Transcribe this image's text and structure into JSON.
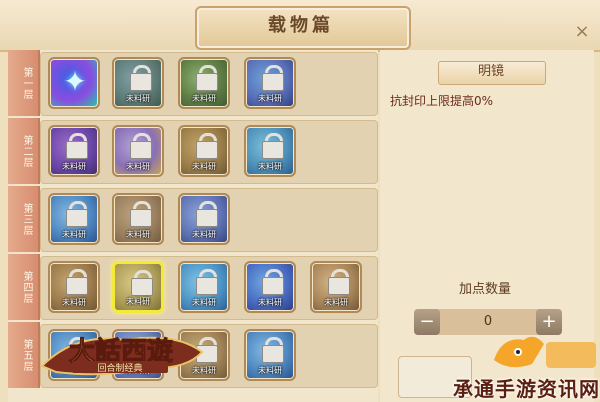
{
  "window": {
    "title": "载物篇",
    "close_glyph": "×"
  },
  "rows": [
    {
      "label": "第一层",
      "slots": [
        {
          "variant": "unlocked",
          "c1": "#3c5fe2",
          "c2": "#8a4de0",
          "c3": "#1ad0a8"
        },
        {
          "variant": "locked",
          "c1": "#7fa0a8",
          "c2": "#5f7c77",
          "c3": "#3d584b"
        },
        {
          "variant": "locked",
          "c1": "#8db06f",
          "c2": "#5e7d46",
          "c3": "#3c5a30"
        },
        {
          "variant": "locked",
          "c1": "#6ca4d8",
          "c2": "#5a6fb9",
          "c3": "#2e3d7a"
        }
      ]
    },
    {
      "label": "第二层",
      "slots": [
        {
          "variant": "locked",
          "c1": "#9e6cc8",
          "c2": "#6b47a8",
          "c3": "#3e2b6a"
        },
        {
          "variant": "locked",
          "c1": "#b0a2d6",
          "c2": "#8a6fb5",
          "c3": "#c7a94e"
        },
        {
          "variant": "locked",
          "c1": "#c2a366",
          "c2": "#9a7d49",
          "c3": "#6b5533"
        },
        {
          "variant": "locked",
          "c1": "#7bc0dc",
          "c2": "#4d8fb8",
          "c3": "#2a5a88"
        }
      ]
    },
    {
      "label": "第三层",
      "slots": [
        {
          "variant": "locked",
          "c1": "#86b9e2",
          "c2": "#4e87c1",
          "c3": "#2a4f87"
        },
        {
          "variant": "locked",
          "c1": "#bca27a",
          "c2": "#9b8060",
          "c3": "#6e5a3e"
        },
        {
          "variant": "locked",
          "c1": "#8aa3d8",
          "c2": "#5f73b4",
          "c3": "#35427c"
        }
      ]
    },
    {
      "label": "第四层",
      "slots": [
        {
          "variant": "locked",
          "c1": "#c4a470",
          "c2": "#9c7b4c",
          "c3": "#6c5431"
        },
        {
          "variant": "locked_selected",
          "c1": "#d8c887",
          "c2": "#b0a05a",
          "c3": "#7d7138"
        },
        {
          "variant": "locked",
          "c1": "#7fc4e6",
          "c2": "#4d94c6",
          "c3": "#2b5c91"
        },
        {
          "variant": "locked",
          "c1": "#6fa9e3",
          "c2": "#4a6cc1",
          "c3": "#2b3b84"
        },
        {
          "variant": "locked",
          "c1": "#d4b384",
          "c2": "#a9865a",
          "c3": "#6d5335"
        }
      ]
    },
    {
      "label": "第五层",
      "slots": [
        {
          "variant": "locked",
          "c1": "#86b9e2",
          "c2": "#4e87c1",
          "c3": "#2a4f87"
        },
        {
          "variant": "locked",
          "c1": "#9ab6dc",
          "c2": "#6780bc",
          "c3": "#3b4b86"
        },
        {
          "variant": "locked",
          "c1": "#c7ab7a",
          "c2": "#a08356",
          "c3": "#6f5838"
        },
        {
          "variant": "locked",
          "c1": "#86b9e2",
          "c2": "#4e87c1",
          "c3": "#2a4f87"
        }
      ]
    }
  ],
  "locked_text": "未料研",
  "detail": {
    "name": "明镜",
    "effect": "抗封印上限提高0%",
    "points_label": "加点数量",
    "points_value": "0",
    "minus_glyph": "−",
    "plus_glyph": "+"
  },
  "logo": {
    "title": "大话西游",
    "subtitle": "回合制经典"
  },
  "watermark": {
    "site": "承通手游资讯网"
  },
  "colors": {
    "accent_row_strip": "#d78d70",
    "selected_border": "#f4ea3a",
    "title_text": "#6b4a2c"
  }
}
